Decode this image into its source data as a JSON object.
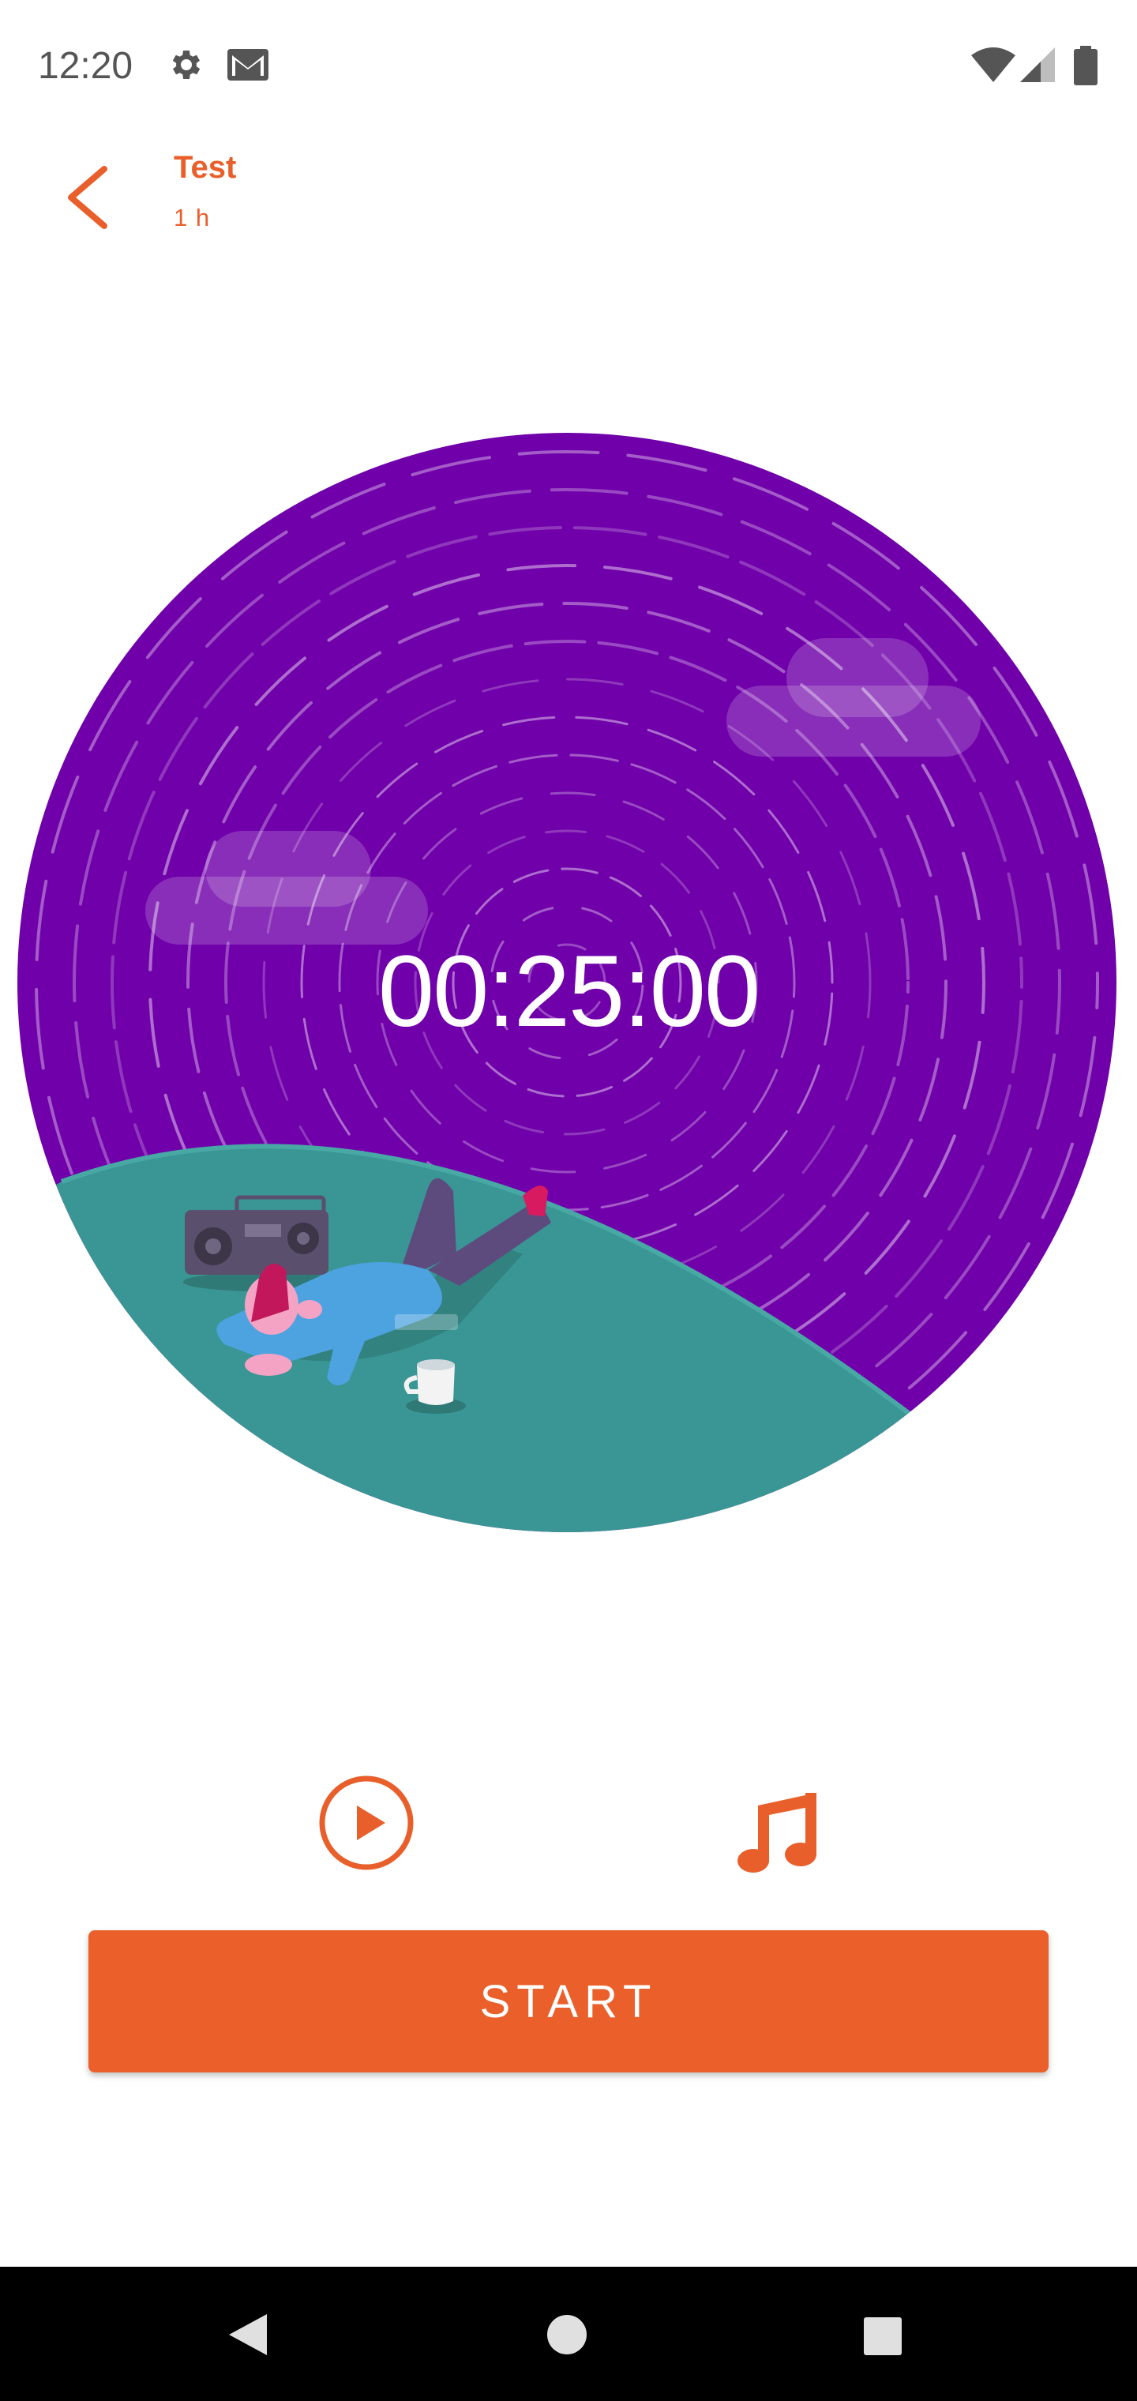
{
  "status_bar": {
    "time": "12:20",
    "icons": [
      "gear-icon",
      "gmail-icon",
      "wifi-icon",
      "signal-icon",
      "battery-icon"
    ]
  },
  "header": {
    "title": "Test",
    "subtitle": "1 h",
    "back_icon": "chevron-left-icon"
  },
  "timer": {
    "display": "00:25:00"
  },
  "controls": {
    "preview_icon": "play-circle-icon",
    "sound_icon": "music-note-icon"
  },
  "start_button": {
    "label": "START"
  },
  "nav_bar": {
    "icons": [
      "back-triangle-icon",
      "home-circle-icon",
      "recents-square-icon"
    ]
  },
  "colors": {
    "accent": "#E95F2B",
    "scene_purple": "#7000AA",
    "grass": "#3A9694",
    "nav_bg": "#000000"
  }
}
